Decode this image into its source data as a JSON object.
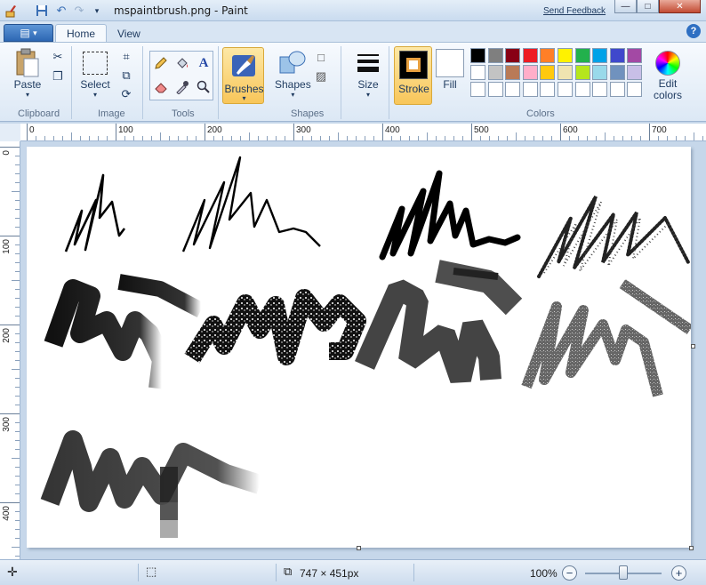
{
  "window": {
    "title": "mspaintbrush.png - Paint",
    "send_feedback": "Send Feedback",
    "minimize": "—",
    "maximize": "□",
    "close": "✕"
  },
  "tabs": [
    {
      "label": "Home",
      "active": true
    },
    {
      "label": "View",
      "active": false
    }
  ],
  "ribbon": {
    "clipboard": {
      "label": "Clipboard",
      "paste": "Paste"
    },
    "image": {
      "label": "Image",
      "select": "Select"
    },
    "tools": {
      "label": "Tools"
    },
    "brushes": {
      "label": "Brushes"
    },
    "shapes": {
      "label": "Shapes",
      "button": "Shapes"
    },
    "size": {
      "label": "Size"
    },
    "stroke": {
      "label": "Stroke"
    },
    "fill": {
      "label": "Fill"
    },
    "colors": {
      "label": "Colors",
      "edit": "Edit colors",
      "palette_row1": [
        "#000000",
        "#7f7f7f",
        "#880015",
        "#ed1c24",
        "#ff7f27",
        "#fff200",
        "#22b14c",
        "#00a2e8",
        "#3f48cc",
        "#a349a4"
      ],
      "palette_row2": [
        "#ffffff",
        "#c3c3c3",
        "#b97a57",
        "#ffaec9",
        "#ffc90e",
        "#efe4b0",
        "#b5e61d",
        "#99d9ea",
        "#7092be",
        "#c8bfe7"
      ],
      "palette_row3": [
        "#ffffff",
        "#ffffff",
        "#ffffff",
        "#ffffff",
        "#ffffff",
        "#ffffff",
        "#ffffff",
        "#ffffff",
        "#ffffff",
        "#ffffff"
      ]
    }
  },
  "rulers": {
    "h_ticks": [
      "0",
      "100",
      "200",
      "300",
      "400",
      "500",
      "600",
      "700"
    ],
    "v_ticks": [
      "0",
      "100",
      "200",
      "300",
      "400"
    ]
  },
  "canvas": {
    "strokes": [
      "calligraphy-1",
      "calligraphy-2",
      "marker",
      "airbrush",
      "oil-brush",
      "crayon",
      "watercolor",
      "natural-pencil",
      "oil-brush-2"
    ]
  },
  "status": {
    "dimensions": "747 × 451px",
    "zoom": "100%",
    "zoom_level": 1.0
  }
}
